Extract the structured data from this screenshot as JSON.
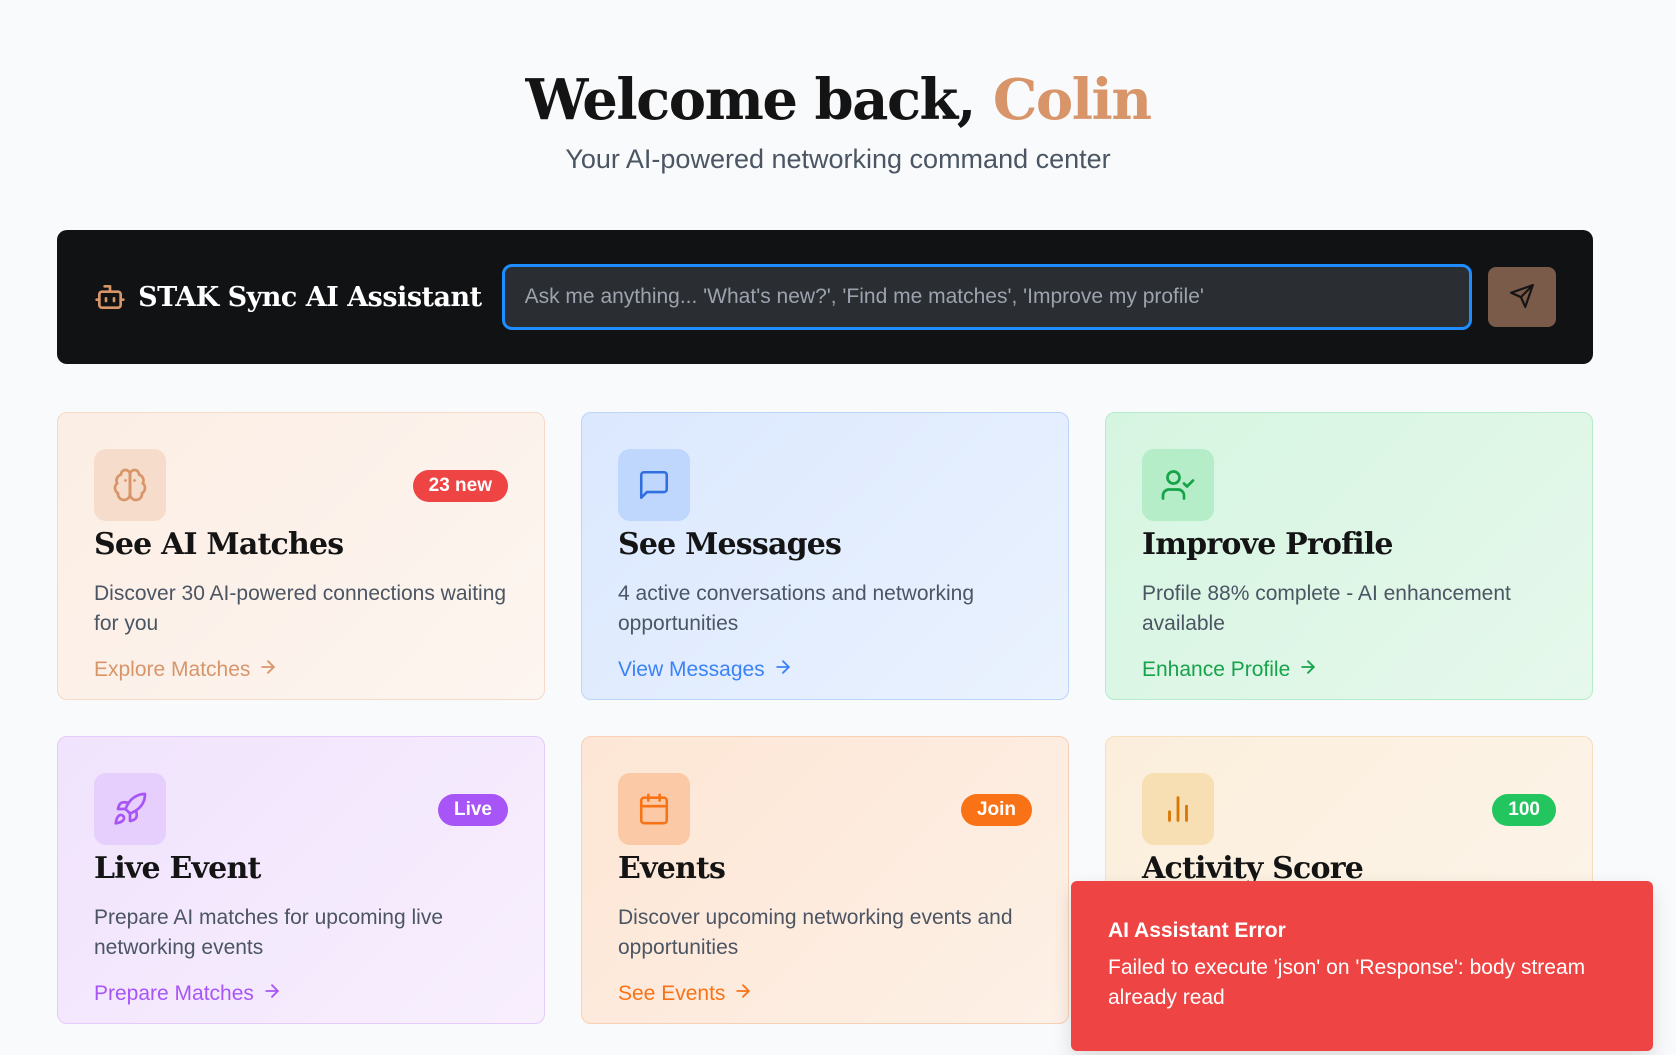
{
  "header": {
    "greeting": "Welcome back,",
    "user_name": "Colin",
    "subtitle": "Your AI-powered networking command center"
  },
  "assistant": {
    "title": "STAK Sync AI Assistant",
    "placeholder": "Ask me anything... 'What's new?', 'Find me matches', 'Improve my profile'",
    "value": "",
    "icon": "bot-icon",
    "send_icon": "send-icon"
  },
  "cards": [
    {
      "title": "See AI Matches",
      "description": "Discover 30 AI-powered connections waiting for you",
      "cta": "Explore Matches",
      "badge": "23 new",
      "icon": "brain-icon",
      "accent": "#d9956a",
      "badge_color": "#ef4444"
    },
    {
      "title": "See Messages",
      "description": "4 active conversations and networking opportunities",
      "cta": "View Messages",
      "badge": "",
      "icon": "message-icon",
      "accent": "#3b82f6"
    },
    {
      "title": "Improve Profile",
      "description": "Profile 88% complete - AI enhancement available",
      "cta": "Enhance Profile",
      "badge": "",
      "icon": "user-check-icon",
      "accent": "#16a34a"
    },
    {
      "title": "Live Event",
      "description": "Prepare AI matches for upcoming live networking events",
      "cta": "Prepare Matches",
      "badge": "Live",
      "icon": "rocket-icon",
      "accent": "#a855f7",
      "badge_color": "#a855f7"
    },
    {
      "title": "Events",
      "description": "Discover upcoming networking events and opportunities",
      "cta": "See Events",
      "badge": "Join",
      "icon": "calendar-icon",
      "accent": "#f97316",
      "badge_color": "#f97316"
    },
    {
      "title": "Activity Score",
      "description": "",
      "cta": "",
      "badge": "100",
      "icon": "bar-chart-icon",
      "accent": "#d97706",
      "badge_color": "#22c55e"
    }
  ],
  "toast": {
    "title": "AI Assistant Error",
    "message": "Failed to execute 'json' on 'Response': body stream already read"
  }
}
